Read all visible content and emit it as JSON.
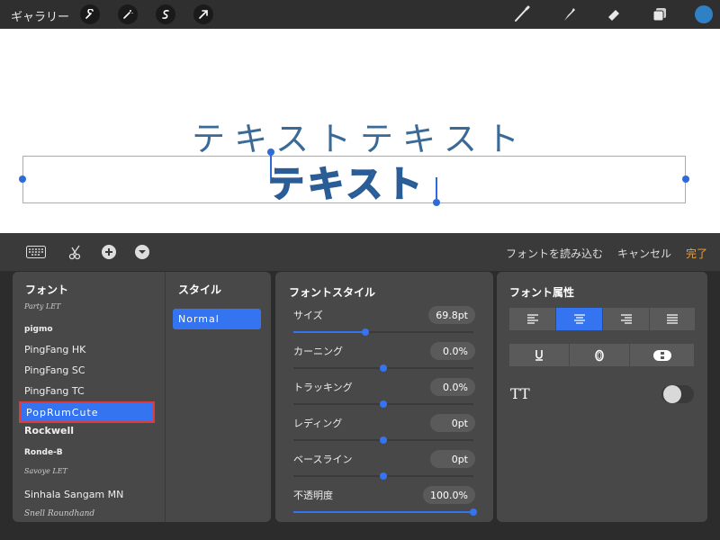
{
  "topbar": {
    "gallery_label": "ギャラリー",
    "tools": [
      "wrench-icon",
      "magic-wand-icon",
      "selection-s-icon",
      "transform-arrow-icon"
    ],
    "right_tools": [
      "brush-icon",
      "smudge-icon",
      "eraser-icon",
      "layers-icon"
    ],
    "color": "#2f80c4"
  },
  "canvas": {
    "text_top": "テキストテキスト",
    "text_main": "テキスト"
  },
  "editbar": {
    "load_font": "フォントを読み込む",
    "cancel": "キャンセル",
    "done": "完了"
  },
  "font_panel": {
    "heading": "フォント",
    "style_heading": "スタイル",
    "fonts": [
      "Party LET",
      "pigmo",
      "PingFang HK",
      "PingFang SC",
      "PingFang TC",
      "PopRumCute",
      "Rockwell",
      "Ronde-B",
      "Savoye LET",
      "Sinhala Sangam MN",
      "Snell Roundhand"
    ],
    "selected_font": "PopRumCute",
    "selected_style": "Normal"
  },
  "font_style": {
    "heading": "フォントスタイル",
    "sliders": [
      {
        "label": "サイズ",
        "value": "69.8pt",
        "level": 0.4
      },
      {
        "label": "カーニング",
        "value": "0.0%",
        "level": 0.5
      },
      {
        "label": "トラッキング",
        "value": "0.0%",
        "level": 0.5
      },
      {
        "label": "レディング",
        "value": "0pt",
        "level": 0.5
      },
      {
        "label": "ベースライン",
        "value": "0pt",
        "level": 0.5
      },
      {
        "label": "不透明度",
        "value": "100.0%",
        "level": 1.0
      }
    ]
  },
  "font_attr": {
    "heading": "フォント属性",
    "tt_label": "TT",
    "align_active": "center",
    "accent": "#3474f0"
  }
}
